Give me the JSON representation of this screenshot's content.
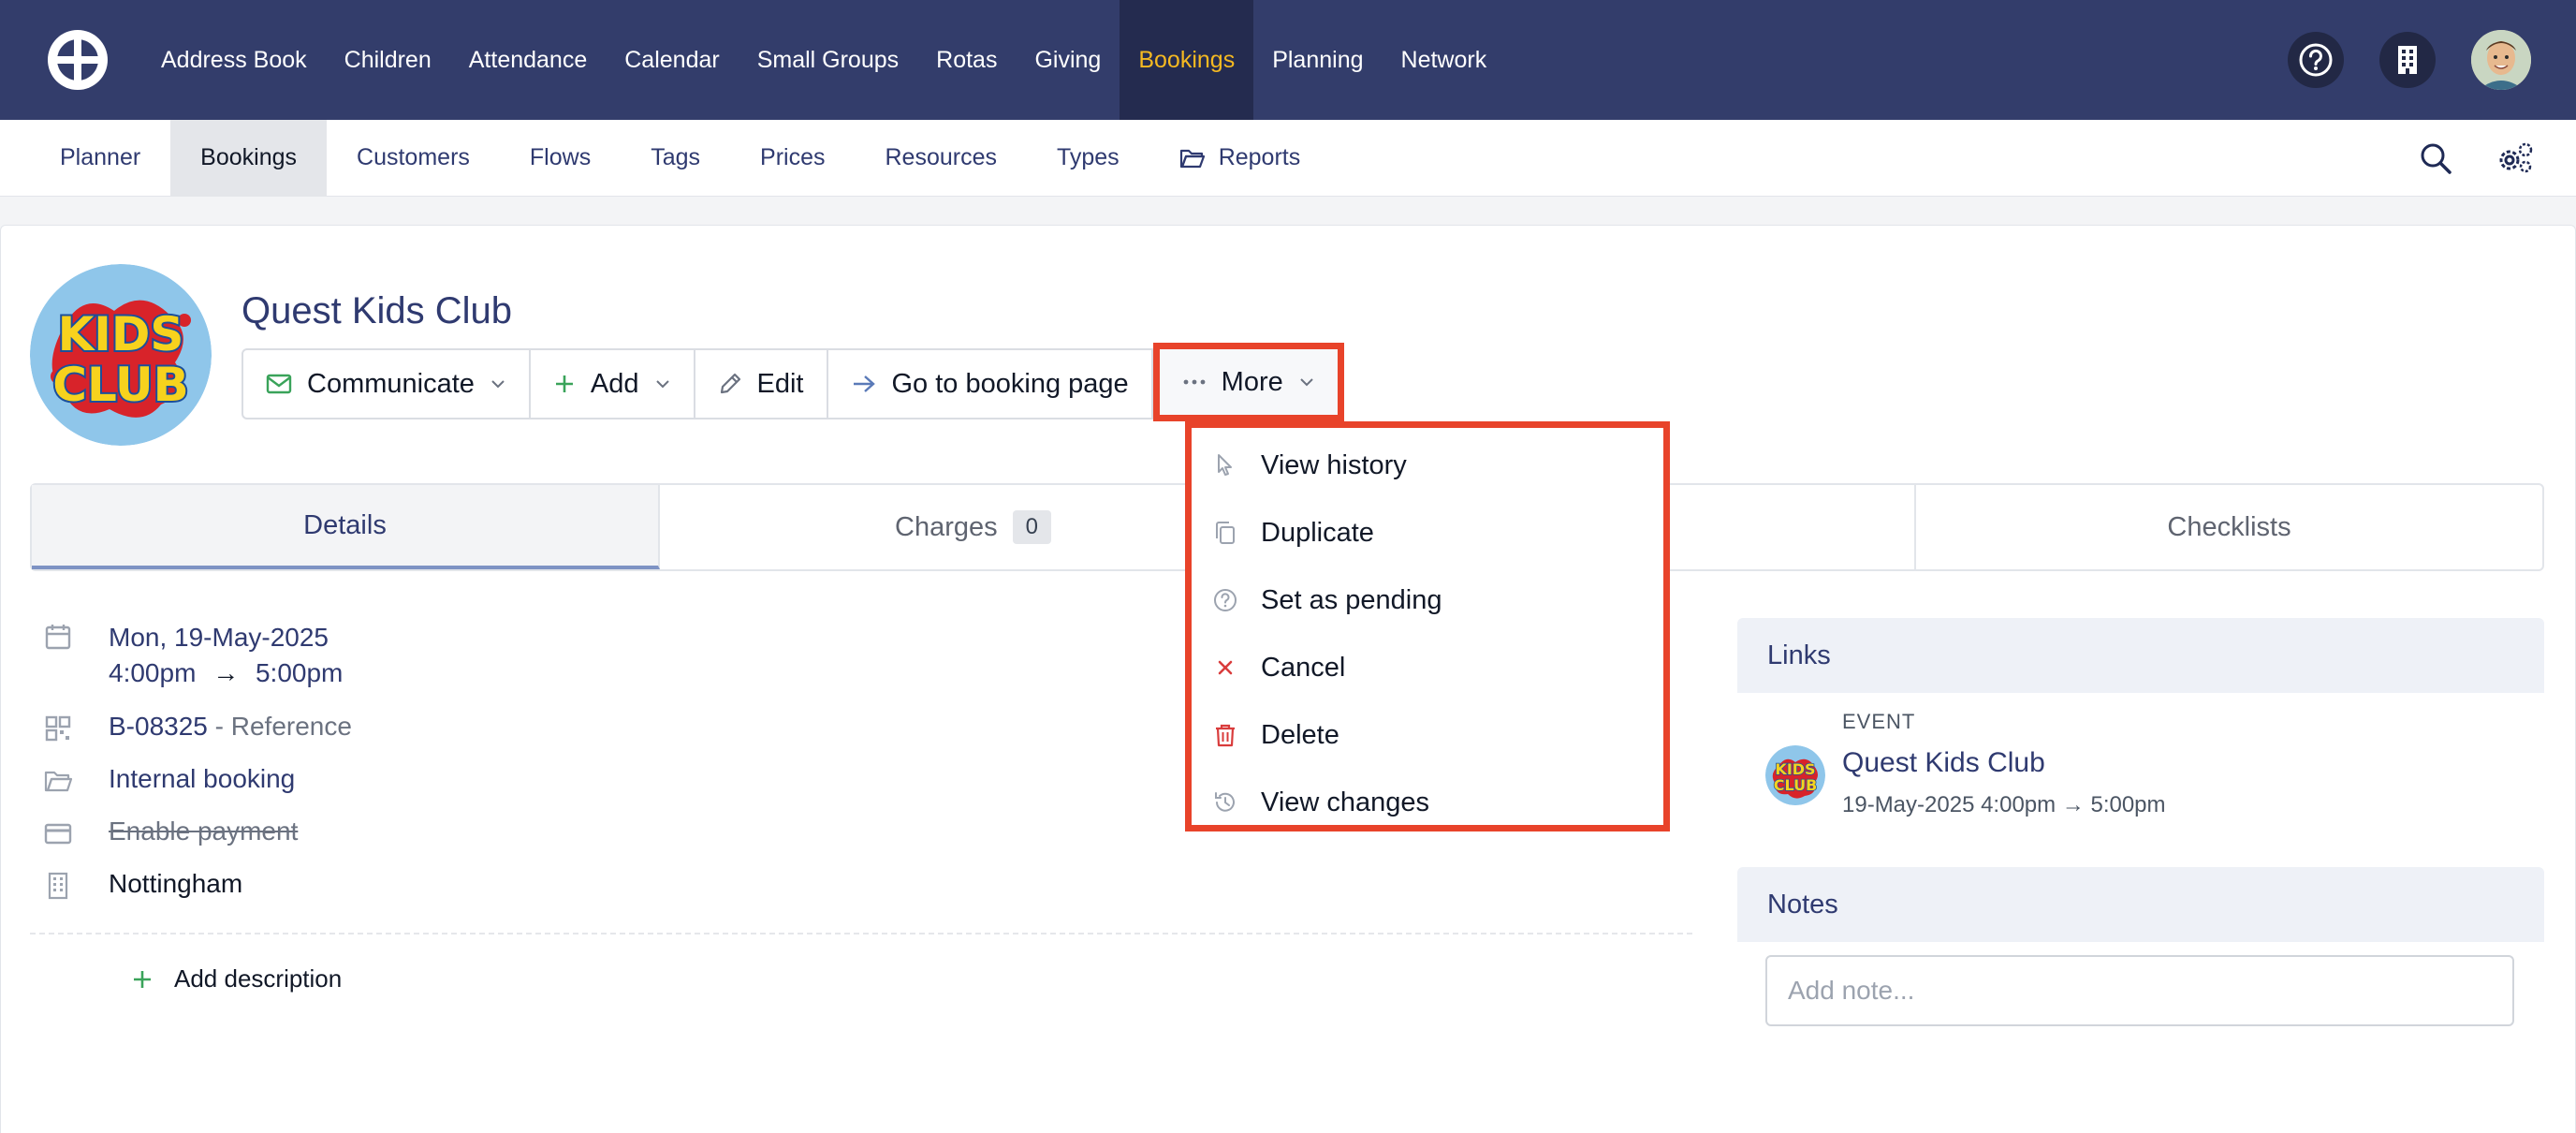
{
  "topnav": {
    "items": [
      "Address Book",
      "Children",
      "Attendance",
      "Calendar",
      "Small Groups",
      "Rotas",
      "Giving",
      "Bookings",
      "Planning",
      "Network"
    ],
    "active": "Bookings",
    "active_color": "#f5b921"
  },
  "subnav": {
    "items": [
      "Planner",
      "Bookings",
      "Customers",
      "Flows",
      "Tags",
      "Prices",
      "Resources",
      "Types",
      "Reports"
    ],
    "active": "Bookings"
  },
  "booking": {
    "logo_text": [
      "KIDS",
      "CLUB"
    ],
    "title": "Quest Kids Club"
  },
  "actions": {
    "communicate": "Communicate",
    "add": "Add",
    "edit": "Edit",
    "go_to_booking_page": "Go to booking page",
    "more": "More"
  },
  "menu": {
    "items": [
      "View history",
      "Duplicate",
      "Set as pending",
      "Cancel",
      "Delete",
      "View changes"
    ]
  },
  "tabs": {
    "details": "Details",
    "charges": "Charges",
    "charges_count": "0",
    "checklists": "Checklists"
  },
  "details": {
    "date": "Mon, 19-May-2025",
    "start_time": "4:00pm",
    "arrow": "→",
    "end_time": "5:00pm",
    "reference_code": "B-08325",
    "reference_label": " - Reference",
    "type": "Internal booking",
    "payment": "Enable payment",
    "location": "Nottingham",
    "add_description": "Add description"
  },
  "sidebar": {
    "links_title": "Links",
    "event_label": "EVENT",
    "event_title": "Quest Kids Club",
    "event_time": "19-May-2025 4:00pm → 5:00pm",
    "notes_title": "Notes",
    "note_placeholder": "Add note..."
  },
  "colors": {
    "nav_bg": "#333d6b",
    "accent": "#2f3a70",
    "highlight": "#e8432a",
    "green": "#3aa35a",
    "danger": "#d93c3c"
  }
}
